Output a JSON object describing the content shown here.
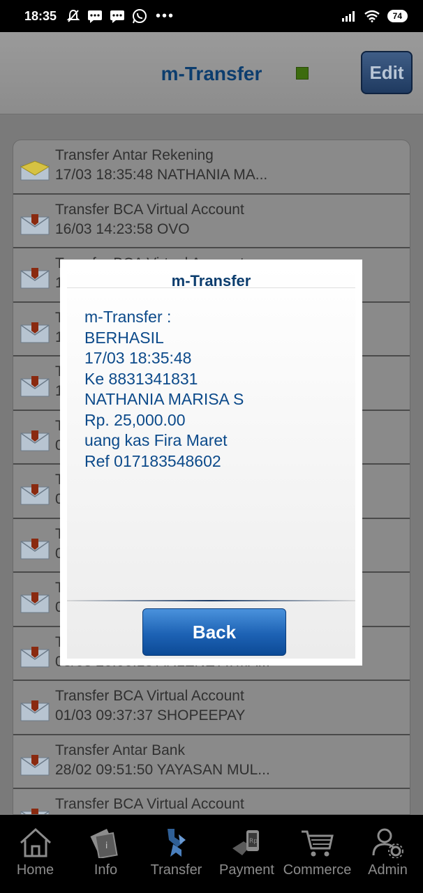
{
  "status": {
    "time": "18:35",
    "battery": "74",
    "left_icons": [
      "mute-bell-icon",
      "message-icon",
      "message-icon",
      "whatsapp-icon"
    ],
    "right_icons": [
      "signal-icon",
      "wifi-icon"
    ]
  },
  "header": {
    "title": "m-Transfer",
    "edit_label": "Edit"
  },
  "list": {
    "items": [
      {
        "line1": "Transfer Antar Rekening",
        "line2": "17/03 18:35:48 NATHANIA MA..."
      },
      {
        "line1": "Transfer BCA Virtual Account",
        "line2": "16/03 14:23:58 OVO"
      },
      {
        "line1": "Transfer BCA Virtual Account",
        "line2": "1"
      },
      {
        "line1": "T",
        "line2": "1"
      },
      {
        "line1": "T",
        "line2": "1"
      },
      {
        "line1": "T",
        "line2": "0"
      },
      {
        "line1": "T",
        "line2": "0"
      },
      {
        "line1": "T",
        "line2": "0"
      },
      {
        "line1": "T",
        "line2": "0"
      },
      {
        "line1": "T",
        "line2": "03/03 20:00:13 ARLENE ATMA..."
      },
      {
        "line1": "Transfer BCA Virtual Account",
        "line2": "01/03 09:37:37 SHOPEEPAY"
      },
      {
        "line1": "Transfer Antar Bank",
        "line2": "28/02 09:51:50 YAYASAN MUL..."
      },
      {
        "line1": "Transfer BCA Virtual Account",
        "line2": ""
      }
    ]
  },
  "dialog": {
    "title": "m-Transfer",
    "lines": [
      "m-Transfer :",
      "BERHASIL",
      "17/03 18:35:48",
      "Ke 8831341831",
      "NATHANIA MARISA S",
      "Rp. 25,000.00",
      "uang kas Fira Maret",
      "Ref 017183548602"
    ],
    "back_label": "Back"
  },
  "nav": {
    "items": [
      {
        "label": "Home",
        "icon": "home-icon"
      },
      {
        "label": "Info",
        "icon": "info-icon"
      },
      {
        "label": "Transfer",
        "icon": "transfer-icon"
      },
      {
        "label": "Payment",
        "icon": "payment-icon"
      },
      {
        "label": "Commerce",
        "icon": "cart-icon"
      },
      {
        "label": "Admin",
        "icon": "admin-icon"
      }
    ]
  }
}
